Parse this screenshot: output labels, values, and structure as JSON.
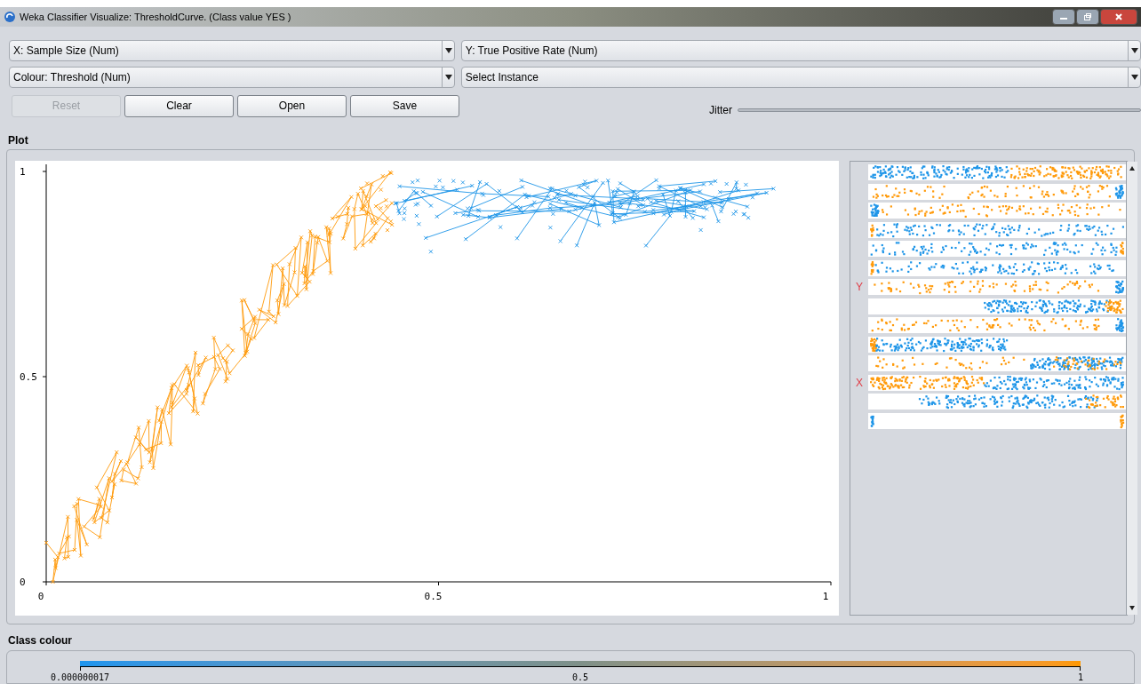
{
  "window": {
    "title": "Weka Classifier Visualize: ThresholdCurve. (Class value YES )"
  },
  "selectors": [
    {
      "value": "X: Sample Size (Num)"
    },
    {
      "value": "Y: True Positive Rate (Num)"
    },
    {
      "value": "Colour: Threshold (Num)"
    },
    {
      "value": "Select Instance"
    }
  ],
  "buttons": [
    {
      "label": "Reset",
      "disabled": true
    },
    {
      "label": "Clear",
      "disabled": false
    },
    {
      "label": "Open",
      "disabled": false
    },
    {
      "label": "Save",
      "disabled": false
    }
  ],
  "jitter": {
    "label": "Jitter"
  },
  "plot": {
    "title": "Plot",
    "yticks": [
      "1",
      "0.5",
      "0"
    ],
    "xticks": [
      "0",
      "0.5",
      "1"
    ]
  },
  "attribute_strips": [
    {
      "kind": "split"
    },
    {
      "kind": "tailblue"
    },
    {
      "kind": "headblue"
    },
    {
      "kind": "headorange"
    },
    {
      "kind": "tailorange"
    },
    {
      "kind": "headorange"
    },
    {
      "kind": "tailblue",
      "marker": "Y"
    },
    {
      "kind": "rightblue"
    },
    {
      "kind": "tailblue"
    },
    {
      "kind": "leftblue"
    },
    {
      "kind": "rightmix"
    },
    {
      "kind": "splitob",
      "marker": "X"
    },
    {
      "kind": "midblue"
    },
    {
      "kind": "ends"
    }
  ],
  "class_colour": {
    "title": "Class colour",
    "ticks": [
      "0.000000017",
      "0.5",
      "1"
    ]
  }
}
